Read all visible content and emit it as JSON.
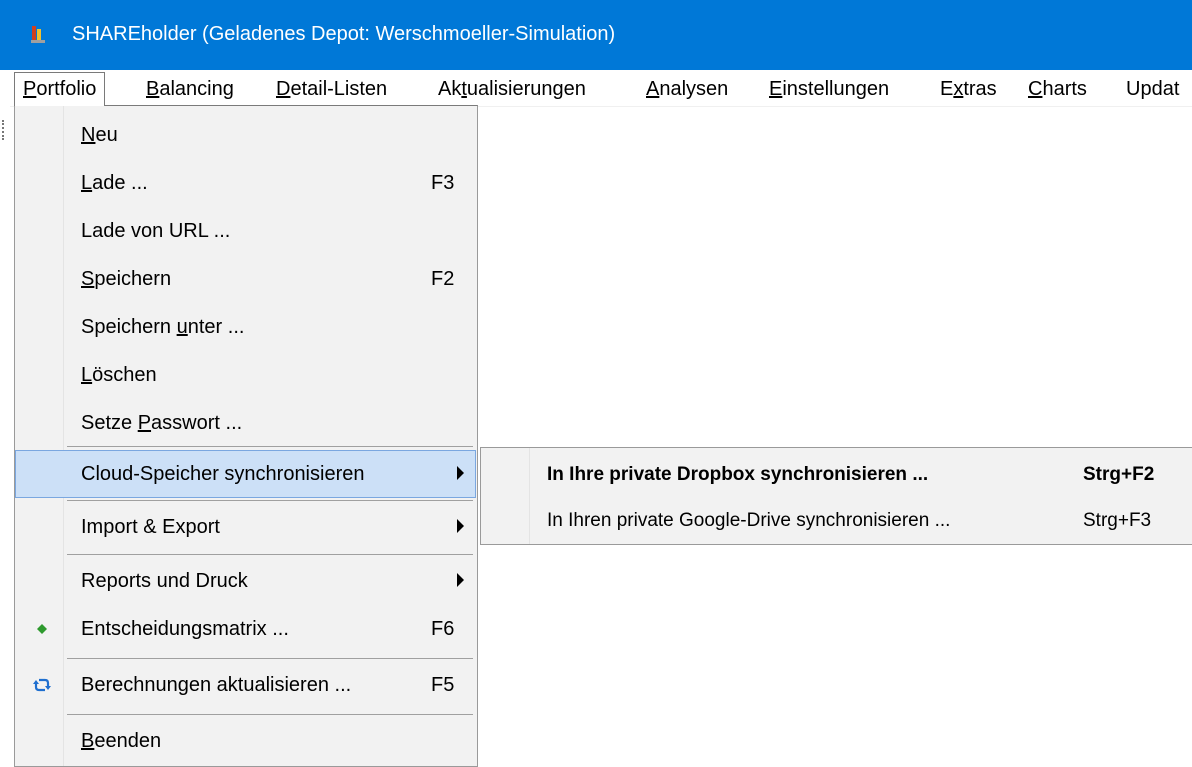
{
  "window": {
    "title": "SHAREholder (Geladenes Depot: Werschmoeller-Simulation)",
    "app_icon": "shareholder-app-icon",
    "accent_color": "#0078d7"
  },
  "menubar": {
    "items": [
      {
        "label": "Portfolio",
        "mnemonic": "P",
        "rest": "ortfolio"
      },
      {
        "label": "Balancing",
        "mnemonic": "B",
        "rest": "alancing"
      },
      {
        "label": "Detail-Listen",
        "mnemonic": "D",
        "rest": "etail-Listen"
      },
      {
        "label": "Aktualisierungen",
        "pre": "Ak",
        "mnemonic": "t",
        "rest": "ualisierungen"
      },
      {
        "label": "Analysen",
        "mnemonic": "A",
        "rest": "nalysen"
      },
      {
        "label": "Einstellungen",
        "mnemonic": "E",
        "rest": "instellungen"
      },
      {
        "label": "Extras",
        "pre": "E",
        "mnemonic": "x",
        "rest": "tras"
      },
      {
        "label": "Charts",
        "mnemonic": "C",
        "rest": "harts"
      },
      {
        "label": "Updat",
        "mnemonic": "",
        "rest": "Updat"
      }
    ]
  },
  "portfolio_menu": {
    "items": {
      "neu": {
        "pre": "",
        "mnemonic": "N",
        "rest": "eu",
        "shortcut": ""
      },
      "lade": {
        "pre": "",
        "mnemonic": "L",
        "rest": "ade ...",
        "shortcut": "F3"
      },
      "lade_url": {
        "pre": "Lade von URL ...",
        "mnemonic": "",
        "rest": "",
        "shortcut": ""
      },
      "speichern": {
        "pre": "",
        "mnemonic": "S",
        "rest": "peichern",
        "shortcut": "F2"
      },
      "speichern_unter": {
        "pre": "Speichern ",
        "mnemonic": "u",
        "rest": "nter ...",
        "shortcut": ""
      },
      "loeschen": {
        "pre": "",
        "mnemonic": "L",
        "rest": "öschen",
        "shortcut": ""
      },
      "passwort": {
        "pre": "Setze ",
        "mnemonic": "P",
        "rest": "asswort ...",
        "shortcut": ""
      },
      "cloud": {
        "label": "Cloud-Speicher synchronisieren"
      },
      "import_export": {
        "label": "Import & Export"
      },
      "reports": {
        "label": "Reports und Druck"
      },
      "matrix": {
        "label": "Entscheidungsmatrix ...",
        "shortcut": "F6",
        "icon": "green-diamond-icon"
      },
      "berechnungen": {
        "label": "Berechnungen aktualisieren ...",
        "shortcut": "F5",
        "icon": "refresh-icon"
      },
      "beenden": {
        "pre": "",
        "mnemonic": "B",
        "rest": "eenden",
        "shortcut": ""
      }
    }
  },
  "cloud_submenu": {
    "items": [
      {
        "label": "In Ihre private Dropbox synchronisieren ...",
        "shortcut": "Strg+F2"
      },
      {
        "label": "In Ihren private Google-Drive synchronisieren ...",
        "shortcut": "Strg+F3"
      }
    ]
  }
}
